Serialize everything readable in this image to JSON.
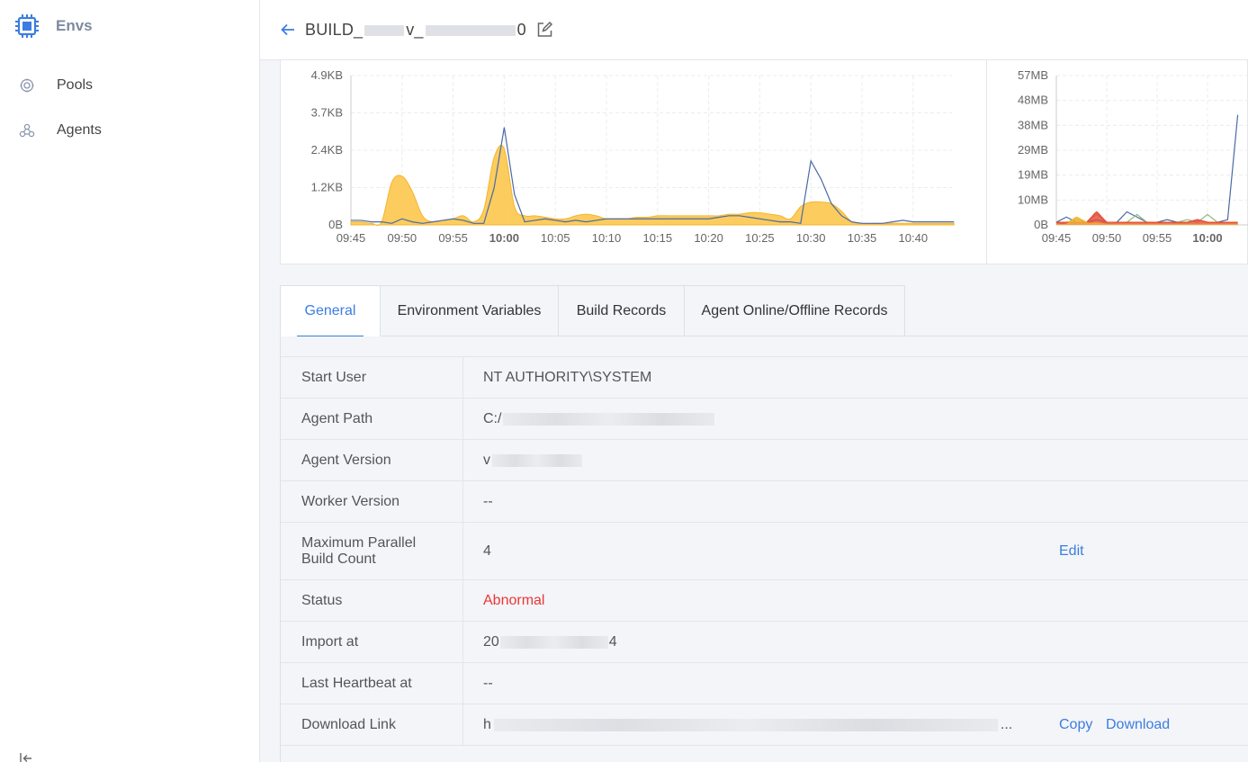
{
  "sidebar": {
    "title": "Envs",
    "items": [
      {
        "label": "Pools",
        "icon": "pool-icon"
      },
      {
        "label": "Agents",
        "icon": "agents-icon"
      }
    ]
  },
  "header": {
    "agent_name_prefix": "BUILD_",
    "agent_name_mid": "v_",
    "agent_name_suffix": "0"
  },
  "charts": {
    "left": {
      "y_ticks": [
        "4.9KB",
        "3.7KB",
        "2.4KB",
        "1.2KB",
        "0B"
      ],
      "x_ticks": [
        "09:45",
        "09:50",
        "09:55",
        "10:00",
        "10:05",
        "10:10",
        "10:15",
        "10:20",
        "10:25",
        "10:30",
        "10:35",
        "10:40"
      ],
      "bold_tick": "10:00"
    },
    "right": {
      "y_ticks": [
        "57MB",
        "48MB",
        "38MB",
        "29MB",
        "19MB",
        "10MB",
        "0B"
      ],
      "x_ticks": [
        "09:45",
        "09:50",
        "09:55",
        "10:00"
      ],
      "bold_tick": "10:00"
    }
  },
  "chart_data": [
    {
      "type": "area",
      "ylim": [
        0,
        4.9
      ],
      "yunit": "KB",
      "x": [
        "09:45",
        "09:46",
        "09:47",
        "09:48",
        "09:49",
        "09:50",
        "09:51",
        "09:52",
        "09:53",
        "09:54",
        "09:55",
        "09:56",
        "09:57",
        "09:58",
        "09:59",
        "10:00",
        "10:01",
        "10:02",
        "10:03",
        "10:04",
        "10:05",
        "10:06",
        "10:07",
        "10:08",
        "10:09",
        "10:10",
        "10:11",
        "10:12",
        "10:13",
        "10:14",
        "10:15",
        "10:16",
        "10:17",
        "10:18",
        "10:19",
        "10:20",
        "10:21",
        "10:22",
        "10:23",
        "10:24",
        "10:25",
        "10:26",
        "10:27",
        "10:28",
        "10:29",
        "10:30",
        "10:31",
        "10:32",
        "10:33",
        "10:34",
        "10:35",
        "10:36",
        "10:37",
        "10:38",
        "10:39",
        "10:40",
        "10:41",
        "10:42",
        "10:43",
        "10:44"
      ],
      "series": [
        {
          "values": [
            0.1,
            0.1,
            0.05,
            0.1,
            1.4,
            1.6,
            1.1,
            0.3,
            0.1,
            0.15,
            0.2,
            0.3,
            0.1,
            0.5,
            2.2,
            2.5,
            0.6,
            0.3,
            0.3,
            0.25,
            0.2,
            0.2,
            0.3,
            0.35,
            0.3,
            0.2,
            0.2,
            0.2,
            0.25,
            0.25,
            0.3,
            0.3,
            0.3,
            0.3,
            0.3,
            0.3,
            0.3,
            0.35,
            0.35,
            0.4,
            0.4,
            0.35,
            0.3,
            0.2,
            0.6,
            0.75,
            0.75,
            0.7,
            0.45,
            0.1,
            0.05,
            0.05,
            0.05,
            0.05,
            0.05,
            0.05,
            0.05,
            0.05,
            0.05,
            0.05
          ]
        },
        {
          "values": [
            0.15,
            0.15,
            0.1,
            0.1,
            0.05,
            0.2,
            0.1,
            0.05,
            0.1,
            0.15,
            0.2,
            0.15,
            0.05,
            0.05,
            1.2,
            3.2,
            1.0,
            0.1,
            0.15,
            0.2,
            0.15,
            0.1,
            0.15,
            0.1,
            0.15,
            0.2,
            0.2,
            0.2,
            0.2,
            0.2,
            0.2,
            0.2,
            0.2,
            0.2,
            0.2,
            0.2,
            0.25,
            0.3,
            0.3,
            0.25,
            0.2,
            0.15,
            0.1,
            0.1,
            0.05,
            2.1,
            1.5,
            0.7,
            0.3,
            0.1,
            0.05,
            0.05,
            0.05,
            0.1,
            0.15,
            0.1,
            0.1,
            0.1,
            0.1,
            0.1
          ]
        }
      ]
    },
    {
      "type": "line",
      "ylim": [
        0,
        57
      ],
      "yunit": "MB",
      "x": [
        "09:45",
        "09:46",
        "09:47",
        "09:48",
        "09:49",
        "09:50",
        "09:51",
        "09:52",
        "09:53",
        "09:54",
        "09:55",
        "09:56",
        "09:57",
        "09:58",
        "09:59",
        "10:00",
        "10:01",
        "10:02",
        "10:03"
      ],
      "series": [
        {
          "values": [
            1,
            3,
            1,
            1,
            2,
            1,
            1,
            5,
            3,
            1,
            1,
            2,
            1,
            1,
            2,
            1,
            1,
            2,
            42
          ]
        },
        {
          "values": [
            1,
            1,
            2,
            1,
            4,
            1,
            1,
            1,
            4,
            1,
            1,
            1,
            1,
            2,
            1,
            4,
            1,
            1,
            1
          ]
        },
        {
          "values": [
            1,
            1,
            1,
            1,
            5,
            1,
            1,
            1,
            1,
            1,
            1,
            1,
            1,
            1,
            2,
            1,
            1,
            1,
            1
          ]
        },
        {
          "values": [
            0.5,
            0.5,
            3,
            1,
            1,
            0.5,
            0.5,
            0.5,
            0.5,
            0.5,
            0.5,
            0.5,
            0.5,
            0.5,
            0.5,
            0.5,
            0.5,
            0.5,
            0.5
          ]
        }
      ]
    }
  ],
  "tabs": [
    "General",
    "Environment Variables",
    "Build Records",
    "Agent Online/Offline Records"
  ],
  "info": {
    "start_user": {
      "label": "Start User",
      "value": "NT AUTHORITY\\SYSTEM"
    },
    "agent_path": {
      "label": "Agent Path",
      "value": "C:/"
    },
    "agent_version": {
      "label": "Agent Version",
      "value": "v"
    },
    "worker_version": {
      "label": "Worker Version",
      "value": "--"
    },
    "max_parallel": {
      "label_line1": "Maximum Parallel",
      "label_line2": "Build Count",
      "value": "4",
      "edit": "Edit"
    },
    "status": {
      "label": "Status",
      "value": "Abnormal"
    },
    "import_at": {
      "label": "Import at",
      "value_start": "20",
      "value_end": "4"
    },
    "last_heartbeat": {
      "label": "Last Heartbeat at",
      "value": "--"
    },
    "download_link": {
      "label": "Download Link",
      "value_start": "h",
      "value_end": "...",
      "copy": "Copy",
      "download": "Download"
    }
  },
  "colors": {
    "accent": "#3c7de0",
    "error": "#ea3636",
    "area_fill": "#fcc64d",
    "line_blue": "#4a6aa5"
  }
}
